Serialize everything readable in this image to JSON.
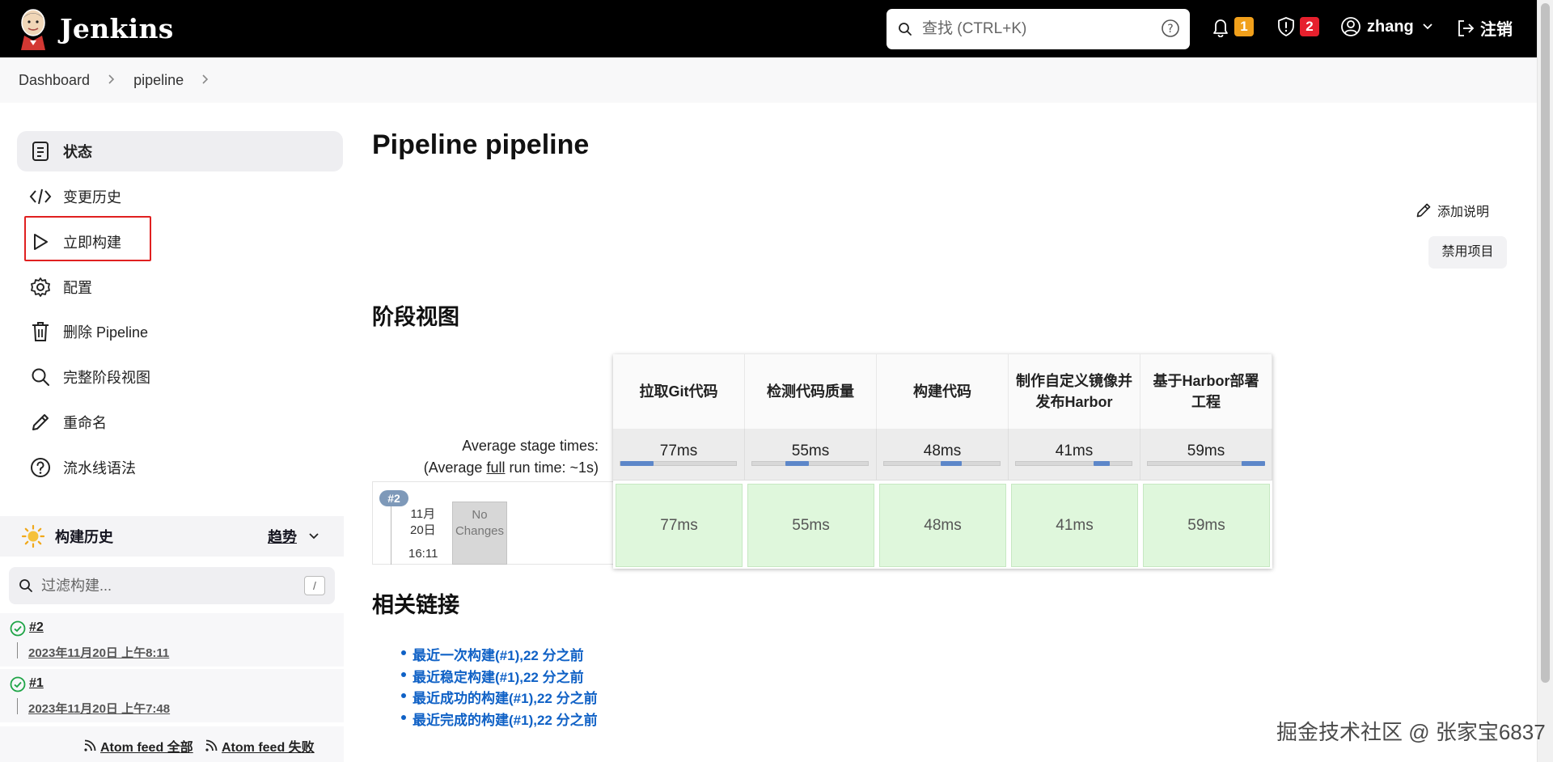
{
  "header": {
    "app_title": "Jenkins",
    "search_placeholder": "查找 (CTRL+K)",
    "notifications_count": "1",
    "security_count": "2",
    "user": "zhang",
    "logout": "注销"
  },
  "breadcrumb": {
    "items": [
      "Dashboard",
      "pipeline"
    ]
  },
  "sidebar": {
    "items": [
      {
        "label": "状态"
      },
      {
        "label": "变更历史"
      },
      {
        "label": "立即构建"
      },
      {
        "label": "配置"
      },
      {
        "label": "删除 Pipeline"
      },
      {
        "label": "完整阶段视图"
      },
      {
        "label": "重命名"
      },
      {
        "label": "流水线语法"
      }
    ]
  },
  "build_history": {
    "title": "构建历史",
    "trend": "趋势",
    "filter_placeholder": "过滤构建...",
    "filter_key": "/",
    "builds": [
      {
        "number": "#2",
        "date": "2023年11月20日 上午8:11"
      },
      {
        "number": "#1",
        "date": "2023年11月20日 上午7:48"
      }
    ],
    "atom_all": "Atom feed 全部",
    "atom_fail": "Atom feed 失败"
  },
  "main": {
    "title": "Pipeline pipeline",
    "add_description": "添加说明",
    "disable_project": "禁用项目",
    "stage_view_title": "阶段视图",
    "related_links_title": "相关链接"
  },
  "stage_view": {
    "avg_label_line1": "Average stage times:",
    "avg_label_line2_prefix": "(Average ",
    "avg_label_line2_link": "full",
    "avg_label_line2_suffix": " run time: ~1s)",
    "stages": [
      {
        "name": "拉取Git代码",
        "avg": "77ms",
        "progress_start": 0.0,
        "progress_end": 0.28
      },
      {
        "name": "检测代码质量",
        "avg": "55ms",
        "progress_start": 0.28,
        "progress_end": 0.48
      },
      {
        "name": "构建代码",
        "avg": "48ms",
        "progress_start": 0.48,
        "progress_end": 0.66
      },
      {
        "name": "制作自定义镜像并发布Harbor",
        "avg": "41ms",
        "progress_start": 0.66,
        "progress_end": 0.8
      },
      {
        "name": "基于Harbor部署工程",
        "avg": "59ms",
        "progress_start": 0.8,
        "progress_end": 1.0
      }
    ],
    "run": {
      "badge": "#2",
      "date_line1": "11月",
      "date_line2": "20日",
      "time": "16:11",
      "no_changes": "No Changes",
      "cells": [
        "77ms",
        "55ms",
        "48ms",
        "41ms",
        "59ms"
      ]
    }
  },
  "related_links": [
    "最近一次构建(#1),22 分之前",
    "最近稳定构建(#1),22 分之前",
    "最近成功的构建(#1),22 分之前",
    "最近完成的构建(#1),22 分之前"
  ],
  "watermark": "掘金技术社区 @ 张家宝6837",
  "colors": {
    "header_bg": "#000000",
    "notification_badge": "#f1a01b",
    "security_badge": "#e6202d",
    "link": "#0f61c6",
    "stage_success": "#dff7dc",
    "progress": "#5d87c9",
    "highlight_box": "#e02020"
  }
}
